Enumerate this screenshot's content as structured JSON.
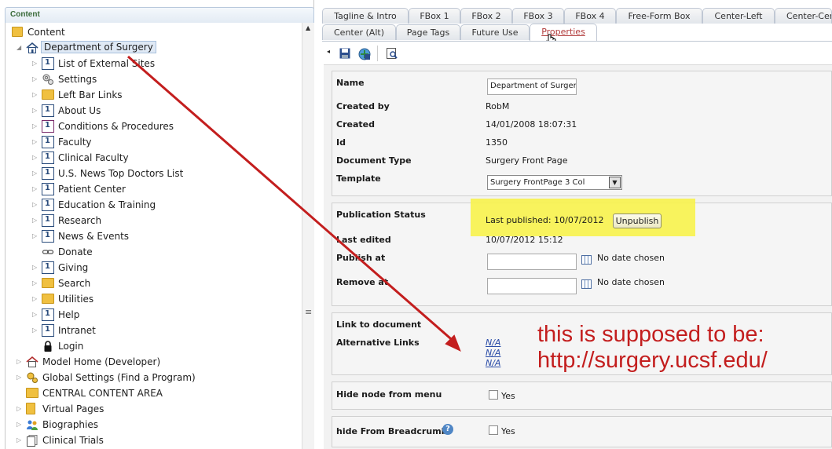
{
  "left_panel": {
    "header": "Content",
    "tree": [
      {
        "label": "Content",
        "icon": "folder-icon"
      },
      {
        "label": "Department of Surgery",
        "icon": "home-icon"
      },
      {
        "label": "List of External Sites",
        "icon": "document-icon"
      },
      {
        "label": "Settings",
        "icon": "settings-icon"
      },
      {
        "label": "Left Bar Links",
        "icon": "folder-icon"
      },
      {
        "label": "About Us",
        "icon": "document-icon"
      },
      {
        "label": "Conditions & Procedures",
        "icon": "document-icon"
      },
      {
        "label": "Faculty",
        "icon": "document-icon"
      },
      {
        "label": "Clinical Faculty",
        "icon": "document-icon"
      },
      {
        "label": "U.S. News Top Doctors List",
        "icon": "document-icon"
      },
      {
        "label": "Patient Center",
        "icon": "document-icon"
      },
      {
        "label": "Education & Training",
        "icon": "document-icon"
      },
      {
        "label": "Research",
        "icon": "document-icon"
      },
      {
        "label": "News & Events",
        "icon": "document-icon"
      },
      {
        "label": "Donate",
        "icon": "link-icon"
      },
      {
        "label": "Giving",
        "icon": "document-icon"
      },
      {
        "label": "Search",
        "icon": "folder-icon"
      },
      {
        "label": "Utilities",
        "icon": "folder-icon"
      },
      {
        "label": "Help",
        "icon": "document-icon"
      },
      {
        "label": "Intranet",
        "icon": "document-icon"
      },
      {
        "label": "Login",
        "icon": "lock-icon"
      },
      {
        "label": "Model Home (Developer)",
        "icon": "home-icon"
      },
      {
        "label": "Global Settings (Find a Program)",
        "icon": "settings-icon"
      },
      {
        "label": "CENTRAL CONTENT AREA",
        "icon": "folder-icon"
      },
      {
        "label": "Virtual Pages",
        "icon": "folder-icon"
      },
      {
        "label": "Biographies",
        "icon": "people-icon"
      },
      {
        "label": "Clinical Trials",
        "icon": "documents-icon"
      }
    ]
  },
  "tabs_row1": [
    "Tagline & Intro",
    "FBox 1",
    "FBox 2",
    "FBox 3",
    "FBox 4",
    "Free-Form Box",
    "Center-Left",
    "Center-Cen"
  ],
  "tabs_row2": [
    "Center (Alt)",
    "Page Tags",
    "Future Use",
    "Properties"
  ],
  "properties": {
    "name_label": "Name",
    "name_value": "Department of Surger",
    "created_by_label": "Created by",
    "created_by_value": "RobM",
    "created_label": "Created",
    "created_value": "14/01/2008 18:07:31",
    "id_label": "Id",
    "id_value": "1350",
    "doctype_label": "Document Type",
    "doctype_value": "Surgery Front Page",
    "template_label": "Template",
    "template_value": "Surgery FrontPage 3 Col",
    "pub_status_label": "Publication Status",
    "last_published": "Last published: 10/07/2012",
    "unpublish_label": "Unpublish",
    "last_edited_label": "Last edited",
    "last_edited_value": "10/07/2012 15:12",
    "publish_at_label": "Publish at",
    "publish_at_value": "No date chosen",
    "remove_at_label": "Remove at",
    "remove_at_value": "No date chosen",
    "link_doc_label": "Link to document",
    "alt_links_label": "Alternative Links",
    "links": [
      "N/A",
      "N/A",
      "N/A"
    ],
    "hide_menu_label": "Hide node from menu",
    "hide_menu_yes": "Yes",
    "hide_bc_label": "hide From Breadcrumb",
    "hide_bc_yes": "Yes"
  },
  "annotation": {
    "line1": "this is supposed to be:",
    "line2": "http://surgery.ucsf.edu/"
  },
  "colors": {
    "annotation_red": "#c31e1e",
    "highlight_yellow": "#f7f24f",
    "active_tab_text": "#b23c3c"
  }
}
